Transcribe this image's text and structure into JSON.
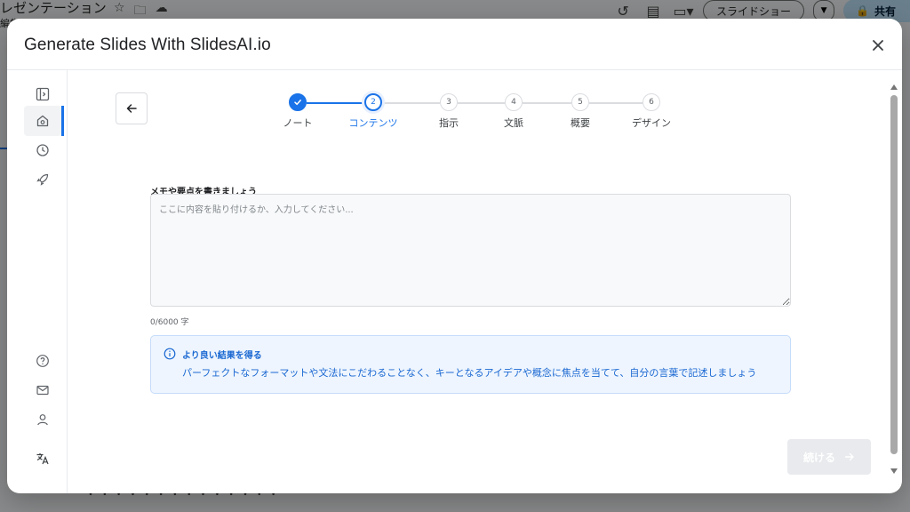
{
  "background": {
    "doc_title": "レゼンテーション",
    "doc_subtitle": "編集",
    "slideshow_label": "スライドショー",
    "share_label": "共有",
    "bottom_text": "・ ・ ・ ・ ・ ・ ・ ・ ・ ・ ・ ・ ・ ・"
  },
  "modal": {
    "title": "Generate Slides With SlidesAI.io",
    "close_icon": "close-icon"
  },
  "stepper": {
    "steps": [
      {
        "number": "1",
        "label": "ノート",
        "state": "done"
      },
      {
        "number": "2",
        "label": "コンテンツ",
        "state": "current"
      },
      {
        "number": "3",
        "label": "指示",
        "state": "pending"
      },
      {
        "number": "4",
        "label": "文脈",
        "state": "pending"
      },
      {
        "number": "5",
        "label": "概要",
        "state": "pending"
      },
      {
        "number": "6",
        "label": "デザイン",
        "state": "pending"
      }
    ]
  },
  "form": {
    "label": "メモや要点を書きましょう",
    "value": "",
    "placeholder": "ここに内容を貼り付けるか、入力してください...",
    "char_count": "0/6000 字"
  },
  "tip": {
    "title": "より良い結果を得る",
    "body": "パーフェクトなフォーマットや文法にこだわることなく、キーとなるアイデアや概念に焦点を当てて、自分の言葉で記述しましょう"
  },
  "actions": {
    "continue_label": "続ける"
  },
  "colors": {
    "accent": "#1a73e8",
    "tip_bg": "#eef5fe",
    "disabled_button": "#e8eaed"
  }
}
